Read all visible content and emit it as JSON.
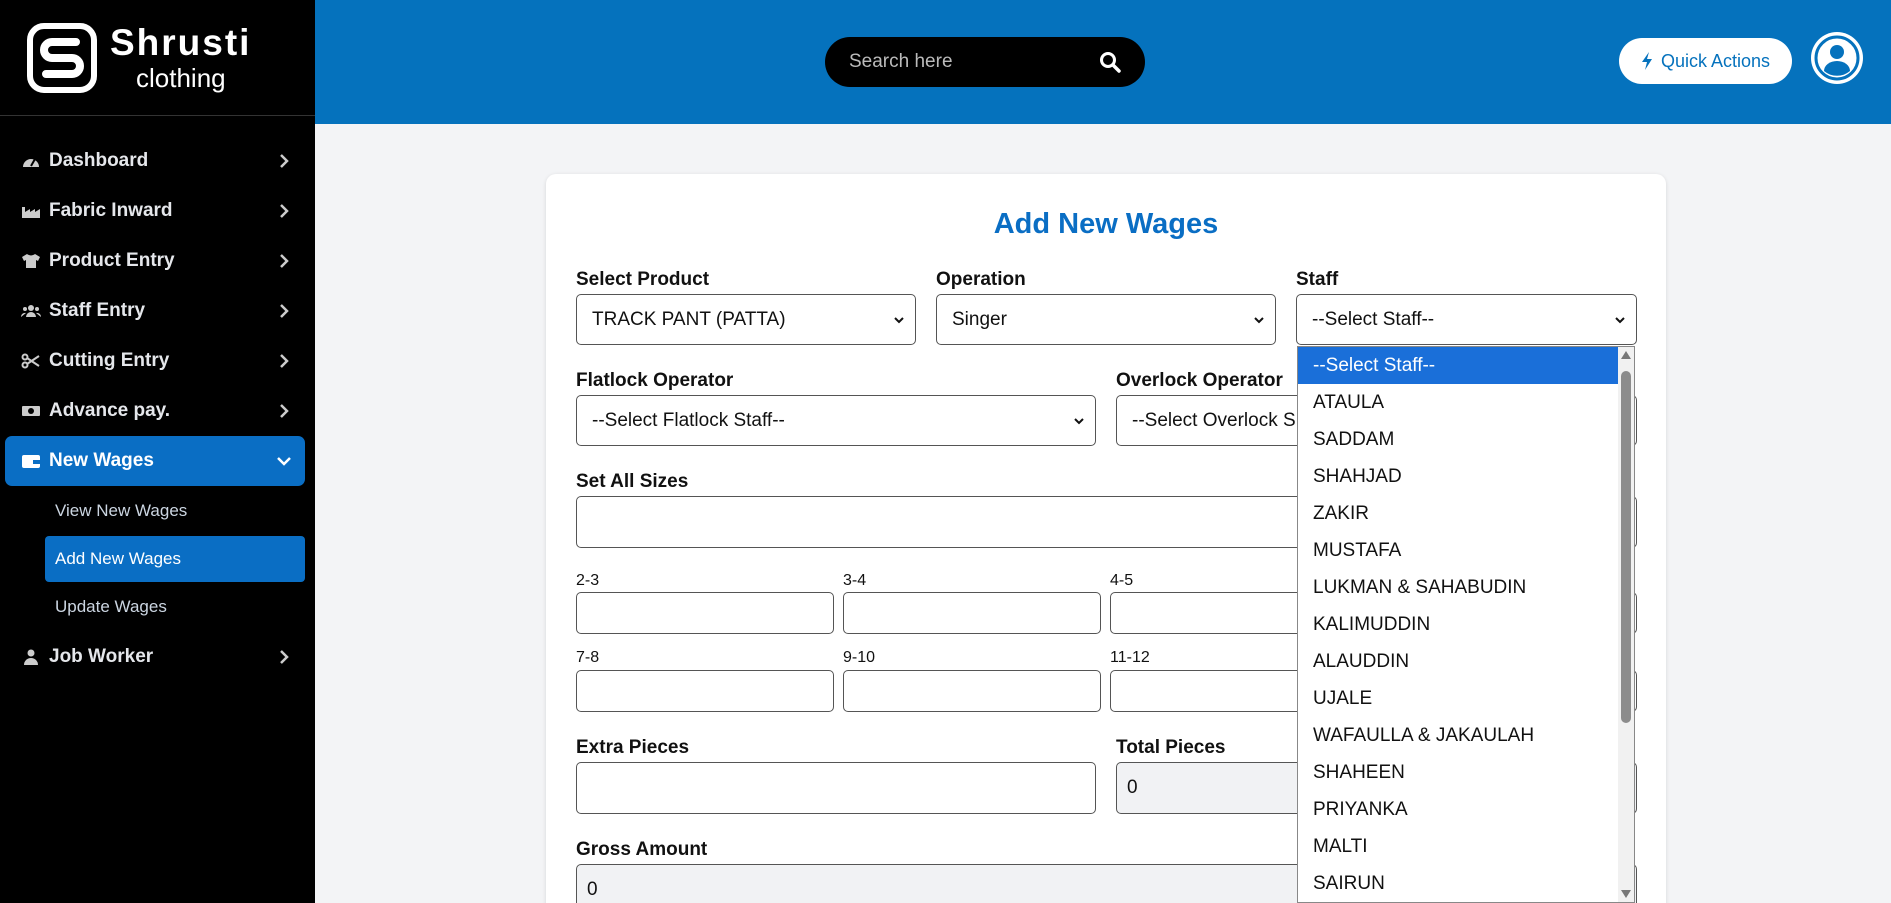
{
  "brand": {
    "name": "Shrusti",
    "sub": "clothing"
  },
  "sidebar": {
    "items": [
      {
        "label": "Dashboard",
        "icon": "gauge-icon"
      },
      {
        "label": "Fabric Inward",
        "icon": "factory-icon"
      },
      {
        "label": "Product Entry",
        "icon": "shirt-icon"
      },
      {
        "label": "Staff Entry",
        "icon": "users-icon"
      },
      {
        "label": "Cutting Entry",
        "icon": "scissors-icon"
      },
      {
        "label": "Advance pay.",
        "icon": "money-icon"
      },
      {
        "label": "New Wages",
        "icon": "wallet-icon",
        "active": true
      },
      {
        "label": "Job Worker",
        "icon": "user-icon"
      }
    ],
    "sub_items": [
      {
        "label": "View New Wages"
      },
      {
        "label": "Add New Wages",
        "active": true
      },
      {
        "label": "Update Wages"
      }
    ]
  },
  "topbar": {
    "search_placeholder": "Search here",
    "quick_actions": "Quick Actions"
  },
  "form": {
    "title": "Add New Wages",
    "select_product": {
      "label": "Select Product",
      "value": "TRACK PANT (PATTA)"
    },
    "operation": {
      "label": "Operation",
      "value": "Singer"
    },
    "staff": {
      "label": "Staff",
      "value": "--Select Staff--"
    },
    "flatlock": {
      "label": "Flatlock Operator",
      "value": "--Select Flatlock Staff--"
    },
    "overlock": {
      "label": "Overlock Operator",
      "value": "--Select Overlock S"
    },
    "set_all_sizes": {
      "label": "Set All Sizes",
      "value": ""
    },
    "sizes_row1": [
      "2-3",
      "3-4",
      "4-5"
    ],
    "sizes_row2": [
      "7-8",
      "9-10",
      "11-12"
    ],
    "extra_pieces": {
      "label": "Extra Pieces",
      "value": ""
    },
    "total_pieces": {
      "label": "Total Pieces",
      "value": "0"
    },
    "gross_amount": {
      "label": "Gross Amount",
      "value": "0"
    }
  },
  "staff_dropdown": {
    "options": [
      "--Select Staff--",
      "ATAULA",
      "SADDAM",
      "SHAHJAD",
      "ZAKIR",
      "MUSTAFA",
      "LUKMAN & SAHABUDIN",
      "KALIMUDDIN",
      "ALAUDDIN",
      "UJALE",
      "WAFAULLA & JAKAULAH",
      "SHAHEEN",
      "PRIYANKA",
      "MALTI",
      "SAIRUN"
    ],
    "selected_index": 0
  },
  "colors": {
    "accent": "#0a6ec4",
    "topbar": "#0572bd",
    "sidebar": "#000000",
    "selected": "#1a6fd9"
  }
}
